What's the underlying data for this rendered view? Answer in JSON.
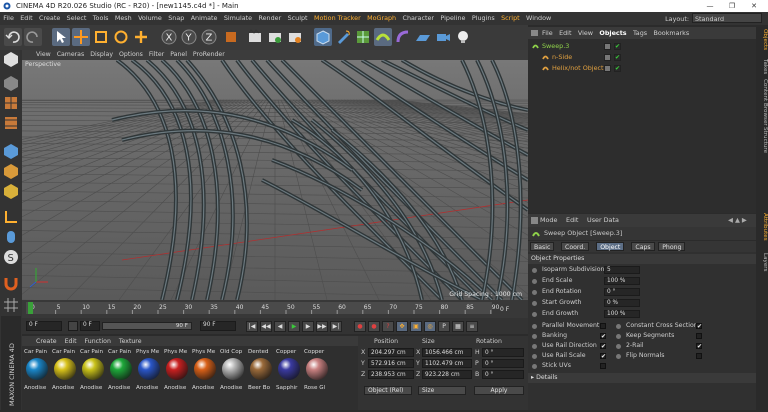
{
  "window": {
    "title": "CINEMA 4D R20.026 Studio (RC - R20) - [new1145.c4d *] - Main"
  },
  "menubar": {
    "items": [
      "File",
      "Edit",
      "Create",
      "Select",
      "Tools",
      "Mesh",
      "Volume",
      "Snap",
      "Animate",
      "Simulate",
      "Render",
      "Sculpt",
      "Motion Tracker",
      "MoGraph",
      "Character",
      "Pipeline",
      "Plugins",
      "Script",
      "Window"
    ],
    "highlighted": [
      "Motion Tracker",
      "MoGraph",
      "Script"
    ],
    "layout_label": "Layout:",
    "layout_value": "Standard"
  },
  "viewport": {
    "menu": [
      "View",
      "Cameras",
      "Display",
      "Options",
      "Filter",
      "Panel",
      "ProRender"
    ],
    "camera_label": "Perspective",
    "grid_spacing": "Grid Spacing : 1000 cm"
  },
  "timeline": {
    "ticks": [
      "0",
      "5",
      "10",
      "15",
      "20",
      "25",
      "30",
      "35",
      "40",
      "45",
      "50",
      "55",
      "60",
      "65",
      "70",
      "75",
      "80",
      "85",
      "90"
    ],
    "end_marker": "0 F"
  },
  "controls": {
    "current_frame": "0 F",
    "start_frame": "0 F",
    "end_frame_slider": "90 F",
    "end_frame": "90 F"
  },
  "material_manager": {
    "menu": [
      "Create",
      "Edit",
      "Function",
      "Texture"
    ],
    "top_row": [
      "Car Pain",
      "Car Pain",
      "Car Pain",
      "Car Pain",
      "Phys Me",
      "Phys Me",
      "Phys Me",
      "Old Cop",
      "Dented",
      "Copper",
      "Copper"
    ],
    "bottom_row": [
      "Anodise",
      "Anodise",
      "Anodise",
      "Anodise",
      "Anodise",
      "Anodise",
      "Anodise",
      "Anodise",
      "Beer Bo",
      "Sapphir",
      "Rose Gl"
    ],
    "colors": [
      "#1a86c8",
      "#d8c21a",
      "#c9c21a",
      "#1ea83a",
      "#2a56c8",
      "#c82020",
      "#d86018",
      "#b8b8b8",
      "#9a6a3a",
      "#3a3aa0",
      "#c88080"
    ]
  },
  "coordinates": {
    "headers": [
      "Position",
      "Size",
      "Rotation"
    ],
    "rows": [
      {
        "axis": "X",
        "pos": "204.297 cm",
        "size": "1056.466 cm",
        "rot_label": "H",
        "rot": "0 °"
      },
      {
        "axis": "Y",
        "pos": "572.916 cm",
        "size": "1102.479 cm",
        "rot_label": "P",
        "rot": "0 °"
      },
      {
        "axis": "Z",
        "pos": "238.953 cm",
        "size": "923.228 cm",
        "rot_label": "B",
        "rot": "0 °"
      }
    ],
    "mode_select": "Object (Rel)",
    "size_select": "Size",
    "apply_label": "Apply"
  },
  "object_manager": {
    "menu": [
      "File",
      "Edit",
      "View",
      "Objects",
      "Tags",
      "Bookmarks"
    ],
    "active_menu": "Objects",
    "objects": [
      {
        "name": "Sweep.3",
        "color": "#8fd24a"
      },
      {
        "name": "n-Side",
        "color": "#e0a040"
      },
      {
        "name": "Helix/not Object",
        "color": "#e0a040"
      }
    ]
  },
  "attributes": {
    "menu": [
      "Mode",
      "Edit",
      "User Data"
    ],
    "title": "Sweep Object [Sweep.3]",
    "tabs": [
      "Basic",
      "Coord.",
      "Object",
      "Caps",
      "Phong"
    ],
    "active_tab": "Object",
    "section_title": "Object Properties",
    "props": [
      {
        "label": "Isoparm Subdivision",
        "value": "5"
      },
      {
        "label": "End Scale",
        "value": "100 %"
      },
      {
        "label": "End Rotation",
        "value": "0 °"
      },
      {
        "label": "Start Growth",
        "value": "0 %"
      },
      {
        "label": "End Growth",
        "value": "100 %"
      }
    ],
    "checks_left": [
      {
        "label": "Parallel Movement",
        "checked": ""
      },
      {
        "label": "Banking",
        "checked": "✔"
      },
      {
        "label": "Use Rail Direction",
        "checked": "✔"
      },
      {
        "label": "Use Rail Scale",
        "checked": "✔"
      },
      {
        "label": "Stick UVs",
        "checked": ""
      }
    ],
    "checks_right": [
      {
        "label": "Constant Cross Section",
        "checked": "✔"
      },
      {
        "label": "Keep Segments",
        "checked": ""
      },
      {
        "label": "2-Rail",
        "checked": "✔"
      },
      {
        "label": "Flip Normals",
        "checked": ""
      }
    ],
    "details_label": "Details"
  },
  "right_strip": {
    "tabs": [
      "Objects",
      "Takes",
      "Content Browser",
      "Structure",
      "Attributes",
      "Layers"
    ]
  },
  "side_logo": "MAXON CINEMA 4D"
}
